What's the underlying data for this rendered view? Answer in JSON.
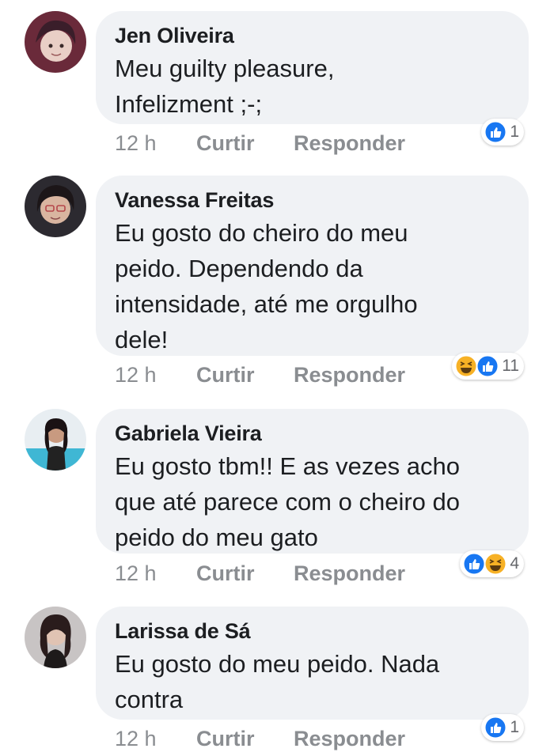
{
  "comments": [
    {
      "author": "Jen Oliveira",
      "text": "Meu guilty pleasure,\nInfelizment ;-;",
      "time": "12 h",
      "like_label": "Curtir",
      "reply_label": "Responder",
      "reaction_count": "1",
      "reactions": [
        "like-icon"
      ]
    },
    {
      "author": "Vanessa Freitas",
      "text": "Eu gosto do cheiro do meu\npeido. Dependendo da\nintensidade, até me orgulho\ndele!",
      "time": "12 h",
      "like_label": "Curtir",
      "reply_label": "Responder",
      "reaction_count": "11",
      "reactions": [
        "haha-icon",
        "like-icon"
      ]
    },
    {
      "author": "Gabriela Vieira",
      "text": "Eu gosto tbm!! E as vezes acho\nque até parece com o cheiro do\npeido do meu gato",
      "time": "12 h",
      "like_label": "Curtir",
      "reply_label": "Responder",
      "reaction_count": "4",
      "reactions": [
        "like-icon",
        "haha-icon"
      ]
    },
    {
      "author": "Larissa de Sá",
      "text": "Eu gosto do meu peido. Nada\ncontra",
      "time": "12 h",
      "like_label": "Curtir",
      "reply_label": "Responder",
      "reaction_count": "1",
      "reactions": [
        "like-icon"
      ]
    }
  ],
  "colors": {
    "bubble": "#f0f2f5",
    "like_blue": "#1877f2",
    "haha_yellow": "#f7b125",
    "meta_gray": "#8a8d91"
  }
}
